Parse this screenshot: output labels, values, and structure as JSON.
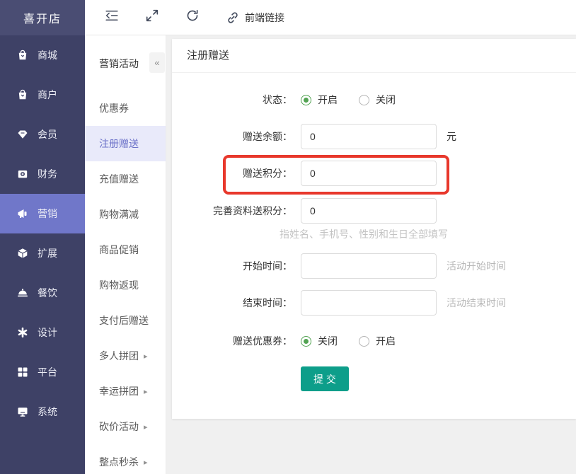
{
  "app": {
    "logo": "喜开店"
  },
  "topbar": {
    "frontend_link_label": "前端链接",
    "icons": [
      {
        "name": "collapse-sidebar-icon"
      },
      {
        "name": "fullscreen-icon"
      },
      {
        "name": "refresh-icon"
      },
      {
        "name": "link-icon"
      }
    ]
  },
  "sidebar": {
    "items": [
      {
        "label": "商城",
        "icon": "shop-bag-icon",
        "active": false
      },
      {
        "label": "商户",
        "icon": "merchant-bag-icon",
        "active": false
      },
      {
        "label": "会员",
        "icon": "gem-icon",
        "active": false
      },
      {
        "label": "财务",
        "icon": "finance-icon",
        "active": false
      },
      {
        "label": "营销",
        "icon": "megaphone-icon",
        "active": true
      },
      {
        "label": "扩展",
        "icon": "cube-icon",
        "active": false
      },
      {
        "label": "餐饮",
        "icon": "cloche-icon",
        "active": false
      },
      {
        "label": "设计",
        "icon": "design-icon",
        "active": false
      },
      {
        "label": "平台",
        "icon": "grid-icon",
        "active": false
      },
      {
        "label": "系统",
        "icon": "monitor-icon",
        "active": false
      }
    ]
  },
  "submenu": {
    "title": "营销活动",
    "collapse_label": "«",
    "arrow_glyph": "▸",
    "items": [
      {
        "label": "优惠券",
        "active": false,
        "has_children": false
      },
      {
        "label": "注册赠送",
        "active": true,
        "has_children": false
      },
      {
        "label": "充值赠送",
        "active": false,
        "has_children": false
      },
      {
        "label": "购物满减",
        "active": false,
        "has_children": false
      },
      {
        "label": "商品促销",
        "active": false,
        "has_children": false
      },
      {
        "label": "购物返现",
        "active": false,
        "has_children": false
      },
      {
        "label": "支付后赠送",
        "active": false,
        "has_children": false
      },
      {
        "label": "多人拼团",
        "active": false,
        "has_children": true
      },
      {
        "label": "幸运拼团",
        "active": false,
        "has_children": true
      },
      {
        "label": "砍价活动",
        "active": false,
        "has_children": true
      },
      {
        "label": "整点秒杀",
        "active": false,
        "has_children": true
      }
    ]
  },
  "main": {
    "panel_title": "注册赠送",
    "form": {
      "status": {
        "label": "状态：",
        "options": [
          {
            "label": "开启",
            "selected": true
          },
          {
            "label": "关闭",
            "selected": false
          }
        ]
      },
      "balance": {
        "label": "赠送余额：",
        "value": "0",
        "suffix": "元"
      },
      "points": {
        "label": "赠送积分：",
        "value": "0"
      },
      "profile_points": {
        "label": "完善资料送积分：",
        "value": "0",
        "hint": "指姓名、手机号、性别和生日全部填写"
      },
      "start_time": {
        "label": "开始时间：",
        "value": "",
        "hint": "活动开始时间"
      },
      "end_time": {
        "label": "结束时间：",
        "value": "",
        "hint": "活动结束时间"
      },
      "coupon": {
        "label": "赠送优惠券：",
        "options": [
          {
            "label": "关闭",
            "selected": true
          },
          {
            "label": "开启",
            "selected": false
          }
        ]
      },
      "submit_label": "提 交"
    }
  },
  "colors": {
    "sidebar_bg": "#3e4166",
    "sidebar_logo_bg": "#4a4d73",
    "sidebar_active": "#7077c9",
    "submenu_active_bg": "#e9eafa",
    "submenu_active_text": "#6a70c8",
    "radio_green": "#52a352",
    "submit_teal": "#0d9e8a",
    "annotation_red": "#e8382c",
    "main_bg": "#f0f0f0"
  }
}
